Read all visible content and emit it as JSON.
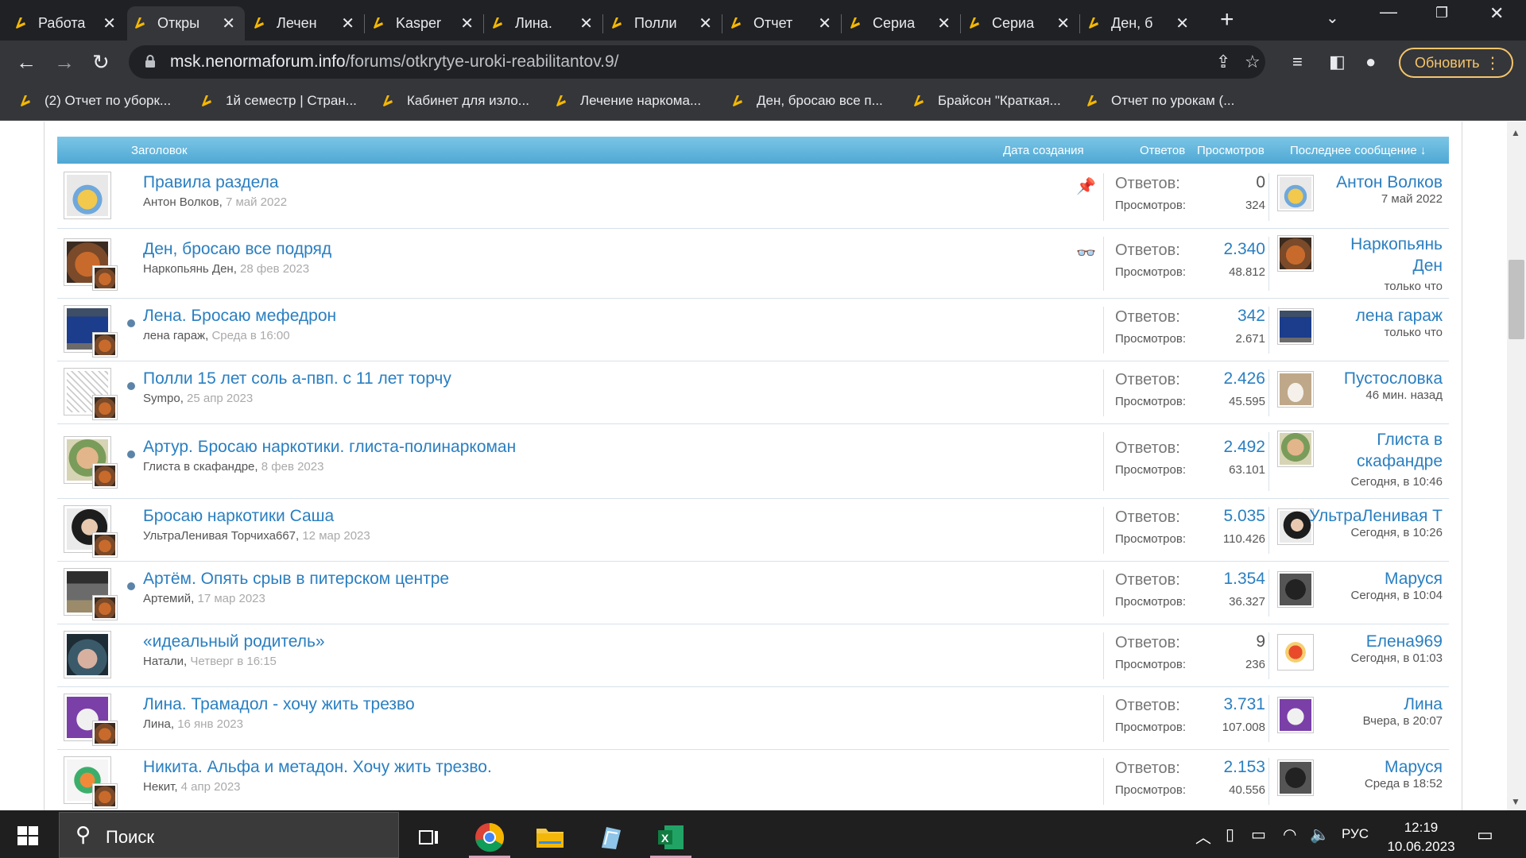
{
  "browser": {
    "tabs": [
      {
        "title": "Работа",
        "active": false
      },
      {
        "title": "Откры",
        "active": true
      },
      {
        "title": "Лечен",
        "active": false
      },
      {
        "title": "Kasper",
        "active": false
      },
      {
        "title": "Лина.",
        "active": false
      },
      {
        "title": "Полли",
        "active": false
      },
      {
        "title": "Отчет",
        "active": false
      },
      {
        "title": "Сериа",
        "active": false
      },
      {
        "title": "Сериа",
        "active": false
      },
      {
        "title": "Ден, б",
        "active": false
      }
    ],
    "url_host": "msk.nenormaforum.info",
    "url_path": "/forums/otkrytye-uroki-reabilitantov.9/",
    "update_label": "Обновить",
    "bookmarks": [
      "(2) Отчет по уборк...",
      "1й семестр | Стран...",
      "Кабинет для изло...",
      "Лечение наркома...",
      "Ден, бросаю все п...",
      "Брайсон \"Краткая...",
      "Отчет по урокам (..."
    ]
  },
  "forum": {
    "header": {
      "title": "Заголовок",
      "created": "Дата создания",
      "replies": "Ответов",
      "views": "Просмотров",
      "last": "Последнее сообщение ↓"
    },
    "labels": {
      "replies": "Ответов:",
      "views": "Просмотров:"
    },
    "threads": [
      {
        "title": "Правила раздела",
        "author": "Антон Волков",
        "date": "7 май 2022",
        "replies": "0",
        "views": "324",
        "last_user": "Антон Волков",
        "last_time": "7 май 2022",
        "flag": "📌",
        "unread": false
      },
      {
        "title": "Ден, бросаю все подряд",
        "author": "Наркопьянь Ден",
        "date": "28 фев 2023",
        "replies": "2.340",
        "views": "48.812",
        "last_user": "Наркопьянь Ден",
        "last_time": "только что",
        "flag": "👓",
        "unread": false
      },
      {
        "title": "Лена. Бросаю мефедрон",
        "author": "лена гараж",
        "date": "Среда в 16:00",
        "replies": "342",
        "views": "2.671",
        "last_user": "лена гараж",
        "last_time": "только что",
        "flag": "",
        "unread": true
      },
      {
        "title": "Полли 15 лет соль а-пвп. с 11 лет торчу",
        "author": "Sympo",
        "date": "25 апр 2023",
        "replies": "2.426",
        "views": "45.595",
        "last_user": "Пустословка",
        "last_time": "46 мин. назад",
        "flag": "",
        "unread": true
      },
      {
        "title": "Артур. Бросаю наркотики. глиста-полинаркоман",
        "author": "Глиста в скафандре",
        "date": "8 фев 2023",
        "replies": "2.492",
        "views": "63.101",
        "last_user": "Глиста в скафандре",
        "last_time": "Сегодня, в 10:46",
        "flag": "",
        "unread": true
      },
      {
        "title": "Бросаю наркотики Саша",
        "author": "УльтраЛенивая Торчиха667",
        "date": "12 мар 2023",
        "replies": "5.035",
        "views": "110.426",
        "last_user": "УльтраЛенивая Т",
        "last_time": "Сегодня, в 10:26",
        "flag": "",
        "unread": false
      },
      {
        "title": "Артём. Опять срыв в питерском центре",
        "author": "Артемий",
        "date": "17 мар 2023",
        "replies": "1.354",
        "views": "36.327",
        "last_user": "Маруся",
        "last_time": "Сегодня, в 10:04",
        "flag": "",
        "unread": true
      },
      {
        "title": "«идеальный родитель»",
        "author": "Натали",
        "date": "Четверг в 16:15",
        "replies": "9",
        "views": "236",
        "last_user": "Елена969",
        "last_time": "Сегодня, в 01:03",
        "flag": "",
        "unread": false
      },
      {
        "title": "Лина. Трамадол - хочу жить трезво",
        "author": "Лина",
        "date": "16 янв 2023",
        "replies": "3.731",
        "views": "107.008",
        "last_user": "Лина",
        "last_time": "Вчера, в 20:07",
        "flag": "",
        "unread": false
      },
      {
        "title": "Никита. Альфа и метадон. Хочу жить трезво.",
        "author": "Некит",
        "date": "4 апр 2023",
        "replies": "2.153",
        "views": "40.556",
        "last_user": "Маруся",
        "last_time": "Среда в 18:52",
        "flag": "",
        "unread": false
      }
    ]
  },
  "taskbar": {
    "search_label": "Поиск",
    "lang": "РУС",
    "time": "12:19",
    "date": "10.06.2023"
  }
}
